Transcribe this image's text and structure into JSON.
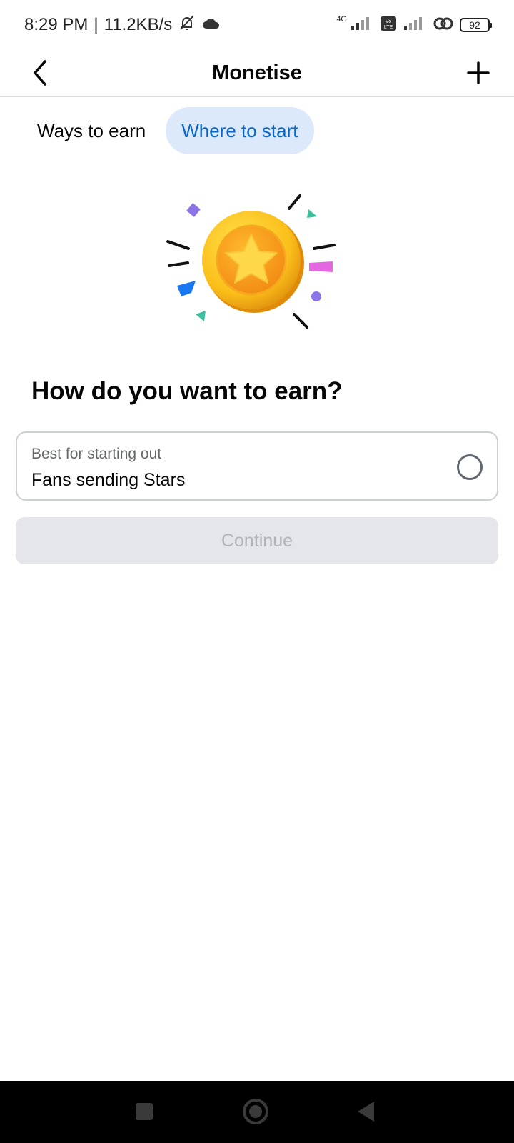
{
  "status_bar": {
    "time": "8:29 PM",
    "separator": "|",
    "speed": "11.2KB/s",
    "network_label": "4G",
    "battery": "92"
  },
  "header": {
    "title": "Monetise"
  },
  "tabs": [
    {
      "label": "Ways to earn",
      "active": false
    },
    {
      "label": "Where to start",
      "active": true
    }
  ],
  "main": {
    "question": "How do you want to earn?",
    "option": {
      "subtitle": "Best for starting out",
      "title": "Fans sending Stars",
      "selected": false
    },
    "continue_label": "Continue"
  },
  "colors": {
    "accent": "#0a66c2",
    "tab_active_bg": "#dbe9fb",
    "disabled_bg": "#e4e6eb",
    "disabled_text": "#b0b3b8",
    "coin": "#f7b928"
  },
  "icons": {
    "back": "arrow-left-icon",
    "add": "plus-icon",
    "nav_recent": "square-icon",
    "nav_home": "circle-icon",
    "nav_back": "triangle-icon"
  }
}
